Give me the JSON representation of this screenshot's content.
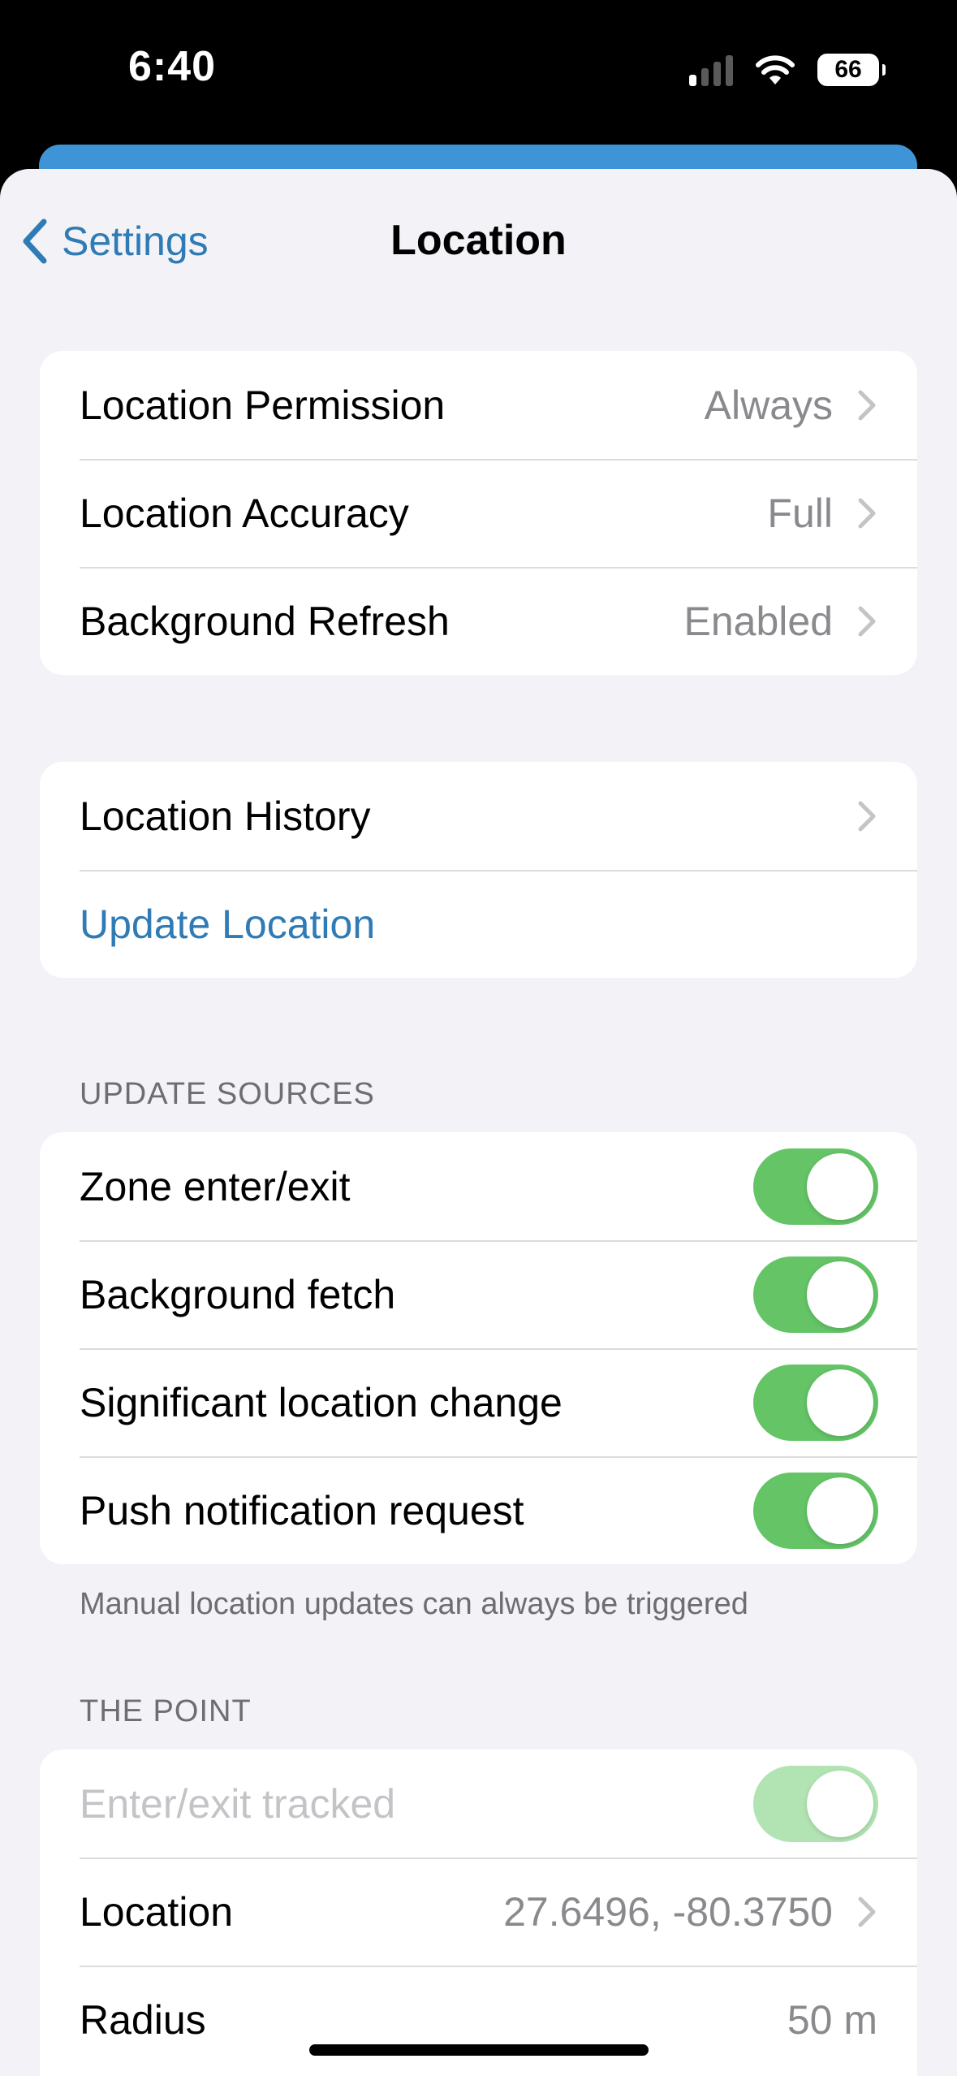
{
  "status": {
    "time": "6:40",
    "battery": "66"
  },
  "nav": {
    "back_label": "Settings",
    "title": "Location"
  },
  "group1": [
    {
      "label": "Location Permission",
      "value": "Always"
    },
    {
      "label": "Location Accuracy",
      "value": "Full"
    },
    {
      "label": "Background Refresh",
      "value": "Enabled"
    }
  ],
  "group2": {
    "history_label": "Location History",
    "update_label": "Update Location"
  },
  "update_sources": {
    "header": "UPDATE SOURCES",
    "items": [
      {
        "label": "Zone enter/exit",
        "on": true
      },
      {
        "label": "Background fetch",
        "on": true
      },
      {
        "label": "Significant location change",
        "on": true
      },
      {
        "label": "Push notification request",
        "on": true
      }
    ],
    "footer": "Manual location updates can always be triggered"
  },
  "the_point": {
    "header": "THE POINT",
    "enter_exit_label": "Enter/exit tracked",
    "enter_exit_on": true,
    "location_label": "Location",
    "location_value": "27.6496, -80.3750",
    "radius_label": "Radius",
    "radius_value": "50 m"
  },
  "colors": {
    "accent": "#2f7bb5",
    "toggle_on": "#64c466",
    "background": "#f2f2f7"
  }
}
